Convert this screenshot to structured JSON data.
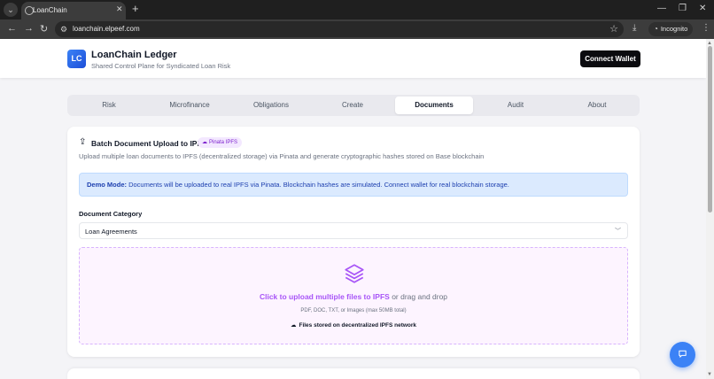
{
  "browser": {
    "tab_title": "LoanChain",
    "url": "loanchain.elpeef.com",
    "incognito_label": "Incognito"
  },
  "header": {
    "logo_text": "LC",
    "title": "LoanChain Ledger",
    "subtitle": "Shared Control Plane for Syndicated Loan Risk",
    "connect_label": "Connect Wallet"
  },
  "tabs": [
    {
      "label": "Risk",
      "active": false
    },
    {
      "label": "Microfinance",
      "active": false
    },
    {
      "label": "Obligations",
      "active": false
    },
    {
      "label": "Create",
      "active": false
    },
    {
      "label": "Documents",
      "active": true
    },
    {
      "label": "Audit",
      "active": false
    },
    {
      "label": "About",
      "active": false
    }
  ],
  "card": {
    "title": "Batch Document Upload to IPFS",
    "badge": "Pinata IPFS",
    "description": "Upload multiple loan documents to IPFS (decentralized storage) via Pinata and generate cryptographic hashes stored on Base blockchain",
    "demo_label": "Demo Mode:",
    "demo_text": " Documents will be uploaded to real IPFS via Pinata. Blockchain hashes are simulated. Connect wallet for real blockchain storage.",
    "category_label": "Document Category",
    "category_value": "Loan Agreements",
    "upload_link": "Click to upload multiple files to IPFS",
    "upload_rest": " or drag and drop",
    "upload_formats": "PDF, DOC, TXT, or Images (max 50MB total)",
    "upload_note": "Files stored on decentralized IPFS network"
  },
  "colors": {
    "accent_purple": "#a855f7",
    "info_blue": "#1e40af",
    "fab_blue": "#3b82f6"
  }
}
